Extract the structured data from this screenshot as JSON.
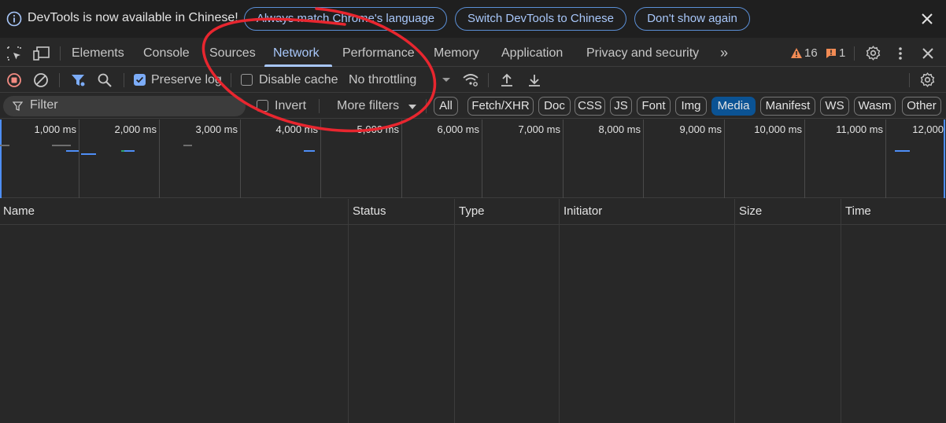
{
  "infobar": {
    "message": "DevTools is now available in Chinese!",
    "buttons": [
      "Always match Chrome's language",
      "Switch DevTools to Chinese",
      "Don't show again"
    ]
  },
  "tabs": [
    "Elements",
    "Console",
    "Sources",
    "Network",
    "Performance",
    "Memory",
    "Application",
    "Privacy and security"
  ],
  "active_tab": "Network",
  "more_tabs": "»",
  "badges": {
    "warnings": "16",
    "issues": "1"
  },
  "toolbar": {
    "preserve_log": "Preserve log",
    "disable_cache": "Disable cache",
    "throttling": "No throttling"
  },
  "filterbar": {
    "filter_placeholder": "Filter",
    "invert": "Invert",
    "more_filters": "More filters",
    "chips": [
      "All",
      "Fetch/XHR",
      "Doc",
      "CSS",
      "JS",
      "Font",
      "Img",
      "Media",
      "Manifest",
      "WS",
      "Wasm",
      "Other"
    ],
    "active_chip": "Media"
  },
  "overview": {
    "ticks": [
      "1,000 ms",
      "2,000 ms",
      "3,000 ms",
      "4,000 ms",
      "5,000 ms",
      "6,000 ms",
      "7,000 ms",
      "8,000 ms",
      "9,000 ms",
      "10,000 ms",
      "11,000 ms",
      "12,000"
    ]
  },
  "table": {
    "columns": [
      "Name",
      "Status",
      "Type",
      "Initiator",
      "Size",
      "Time"
    ]
  },
  "colors": {
    "accent": "#a8c7fa",
    "annotation": "#e8262f",
    "warning": "#f28b54",
    "request_bar": "#4e8ef7"
  }
}
